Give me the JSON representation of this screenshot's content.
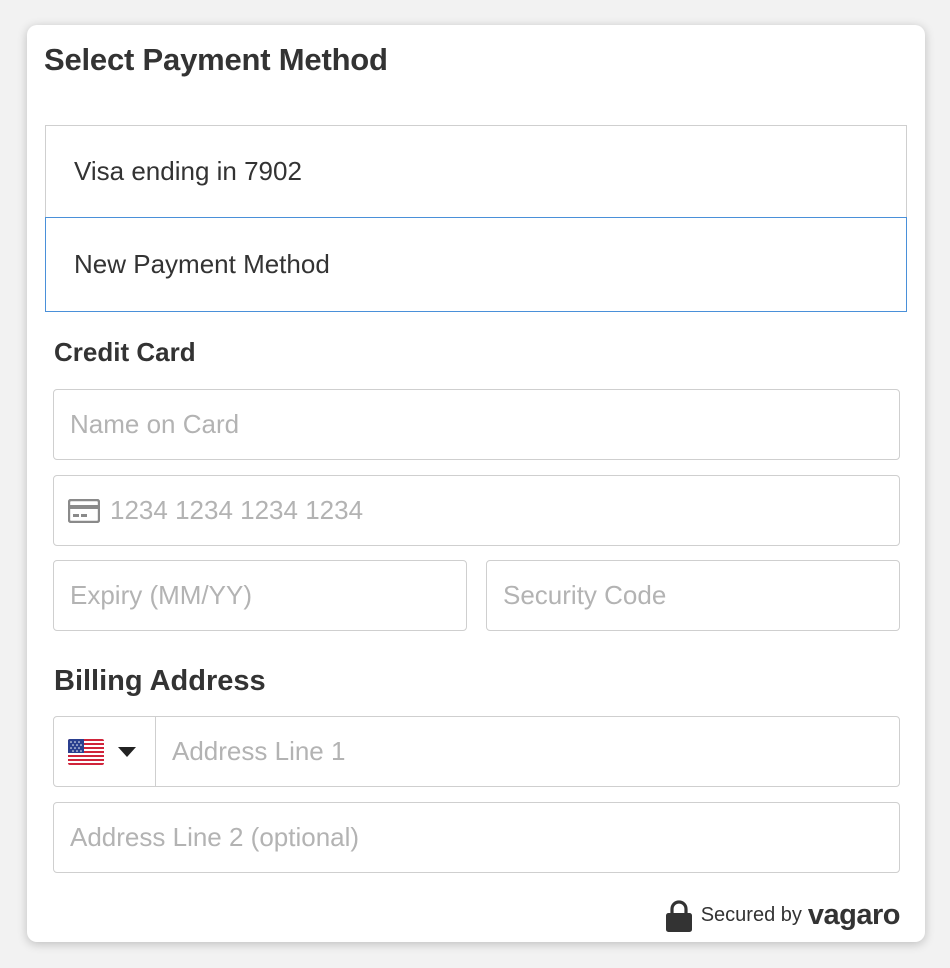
{
  "title": "Select Payment Method",
  "payment_methods": [
    {
      "label": "Visa ending in 7902",
      "selected": false
    },
    {
      "label": "New Payment Method",
      "selected": true
    }
  ],
  "credit_card": {
    "heading": "Credit Card",
    "name_placeholder": "Name on Card",
    "number_placeholder": "1234 1234 1234 1234",
    "expiry_placeholder": "Expiry (MM/YY)",
    "security_placeholder": "Security Code",
    "card_icon": "credit-card-icon"
  },
  "billing": {
    "heading": "Billing Address",
    "country_flag": "us-flag-icon",
    "address1_placeholder": "Address Line 1",
    "address2_placeholder": "Address Line 2 (optional)"
  },
  "footer": {
    "secured_text": "Secured by",
    "brand": "vagaro",
    "lock_icon": "lock-icon"
  },
  "colors": {
    "selected_border": "#4a90d9",
    "text": "#333333",
    "placeholder": "#b3b3b3",
    "border": "#cfcfcf"
  }
}
